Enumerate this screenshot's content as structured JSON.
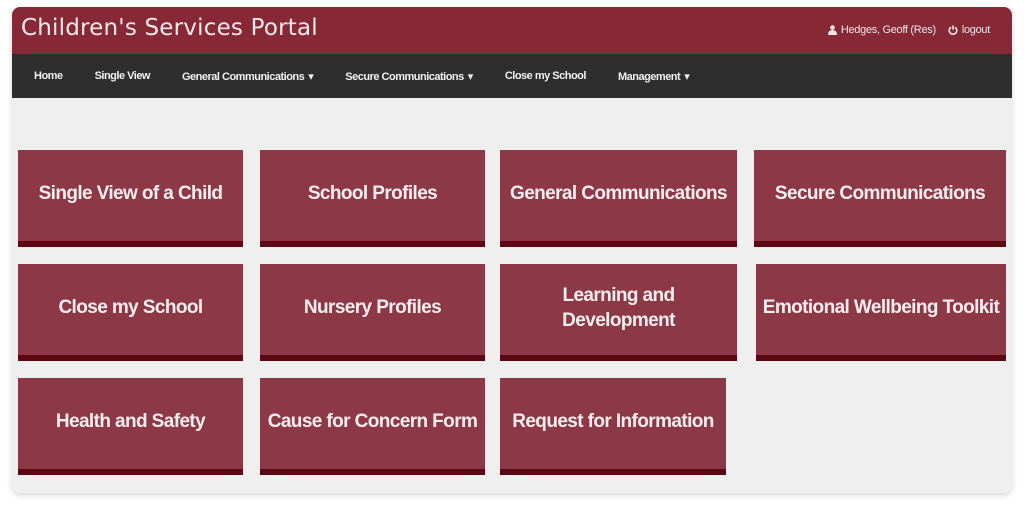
{
  "header": {
    "title": "Children's Services Portal",
    "user_icon": "user-icon",
    "user_name": "Hedges, Geoff (Res)",
    "logout_icon": "power-icon",
    "logout_label": "logout"
  },
  "nav": {
    "items": [
      {
        "label": "Home",
        "dropdown": false
      },
      {
        "label": "Single View",
        "dropdown": false
      },
      {
        "label": "General Communications",
        "dropdown": true
      },
      {
        "label": "Secure Communications",
        "dropdown": true
      },
      {
        "label": "Close my School",
        "dropdown": false
      },
      {
        "label": "Management",
        "dropdown": true
      }
    ],
    "caret": "▾"
  },
  "tiles": [
    {
      "label": "Single View of a Child"
    },
    {
      "label": "School Profiles"
    },
    {
      "label": "General Communications"
    },
    {
      "label": "Secure Communications"
    },
    {
      "label": "Close my School"
    },
    {
      "label": "Nursery Profiles"
    },
    {
      "label": "Learning and Development"
    },
    {
      "label": "Emotional Wellbeing Toolkit"
    },
    {
      "label": "Health and Safety"
    },
    {
      "label": "Cause for Concern Form"
    },
    {
      "label": "Request for Information"
    }
  ],
  "colors": {
    "brand": "#862836",
    "nav_bg": "#2e2e2e",
    "tile_bg": "#8c3847",
    "tile_border": "#5c0712",
    "page_bg": "#efefef"
  }
}
